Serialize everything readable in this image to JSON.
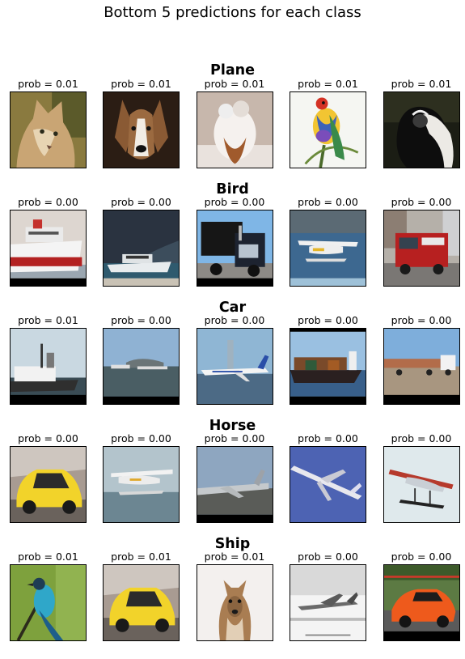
{
  "figure_title": "Bottom 5 predictions for each class",
  "rows": [
    {
      "title": "Plane",
      "items": [
        {
          "prob": "prob = 0.01",
          "picture": "cougar"
        },
        {
          "prob": "prob = 0.01",
          "picture": "dog"
        },
        {
          "prob": "prob = 0.01",
          "picture": "fluffy-cat"
        },
        {
          "prob": "prob = 0.01",
          "picture": "finch"
        },
        {
          "prob": "prob = 0.01",
          "picture": "colobus-monkey"
        }
      ]
    },
    {
      "title": "Bird",
      "items": [
        {
          "prob": "prob = 0.00",
          "picture": "ferry-ship"
        },
        {
          "prob": "prob = 0.00",
          "picture": "boat-cliff"
        },
        {
          "prob": "prob = 0.00",
          "picture": "truck"
        },
        {
          "prob": "prob = 0.00",
          "picture": "seaplane-water"
        },
        {
          "prob": "prob = 0.00",
          "picture": "fire-truck"
        }
      ]
    },
    {
      "title": "Car",
      "items": [
        {
          "prob": "prob = 0.01",
          "picture": "tugboat"
        },
        {
          "prob": "prob = 0.00",
          "picture": "ship-distant"
        },
        {
          "prob": "prob = 0.00",
          "picture": "airliner-ground"
        },
        {
          "prob": "prob = 0.00",
          "picture": "cargo-ship"
        },
        {
          "prob": "prob = 0.00",
          "picture": "log-truck"
        }
      ]
    },
    {
      "title": "Horse",
      "items": [
        {
          "prob": "prob = 0.00",
          "picture": "yellow-car"
        },
        {
          "prob": "prob = 0.00",
          "picture": "seaplane-sky"
        },
        {
          "prob": "prob = 0.00",
          "picture": "airliner-tarmac"
        },
        {
          "prob": "prob = 0.00",
          "picture": "jet-sky"
        },
        {
          "prob": "prob = 0.00",
          "picture": "floatplane"
        }
      ]
    },
    {
      "title": "Ship",
      "items": [
        {
          "prob": "prob = 0.01",
          "picture": "blue-bird"
        },
        {
          "prob": "prob = 0.01",
          "picture": "yellow-car"
        },
        {
          "prob": "prob = 0.01",
          "picture": "deer"
        },
        {
          "prob": "prob = 0.00",
          "picture": "fighter-jet"
        },
        {
          "prob": "prob = 0.00",
          "picture": "orange-sports-car"
        }
      ]
    }
  ]
}
